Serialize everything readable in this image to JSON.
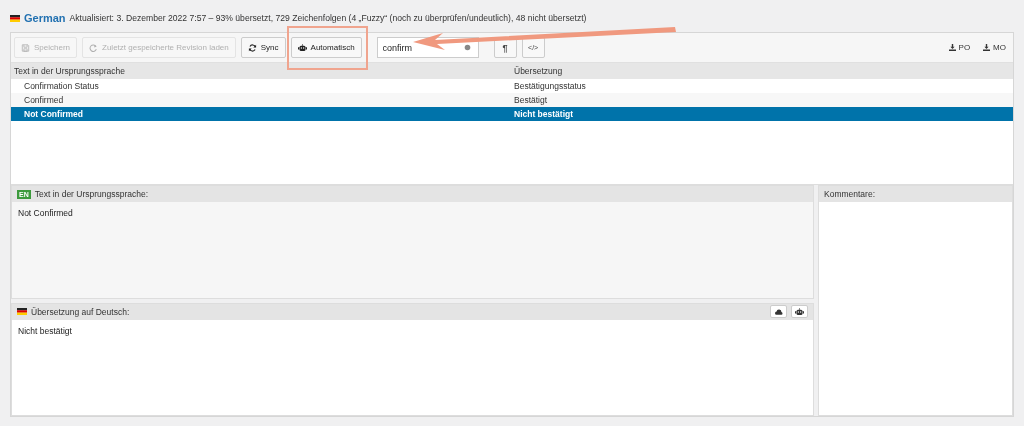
{
  "header": {
    "language": "German",
    "status": "Aktualisiert: 3. Dezember 2022 7:57 – 93% übersetzt, 729 Zeichenfolgen (4 „Fuzzy“ (noch zu überprüfen/undeutlich), 48 nicht übersetzt)"
  },
  "toolbar": {
    "buttons": [
      {
        "label": "Speichern",
        "kind": "save",
        "disabled": true
      },
      {
        "label": "Zuletzt gespeicherte Revision laden",
        "kind": "revert",
        "disabled": true
      },
      {
        "label": "Sync",
        "kind": "sync",
        "disabled": false
      },
      {
        "label": "Automatisch",
        "kind": "auto",
        "disabled": false
      }
    ],
    "search": {
      "value": "confirm"
    },
    "format_buttons": [
      "¶",
      "</>"
    ],
    "downloads": [
      "PO",
      "MO"
    ]
  },
  "table": {
    "columns": [
      "Text in der Ursprungssprache",
      "Übersetzung"
    ],
    "rows": [
      {
        "source": "Confirmation Status",
        "translation": "Bestätigungsstatus",
        "selected": false
      },
      {
        "source": "Confirmed",
        "translation": "Bestätigt",
        "selected": false
      },
      {
        "source": "Not Confirmed",
        "translation": "Nicht bestätigt",
        "selected": true
      }
    ]
  },
  "source_panel": {
    "badge": "EN",
    "title": "Text in der Ursprungssprache:",
    "text": "Not Confirmed"
  },
  "translation_panel": {
    "title": "Übersetzung auf Deutsch:",
    "text": "Nicht bestätigt"
  },
  "comments_panel": {
    "title": "Kommentare:"
  }
}
